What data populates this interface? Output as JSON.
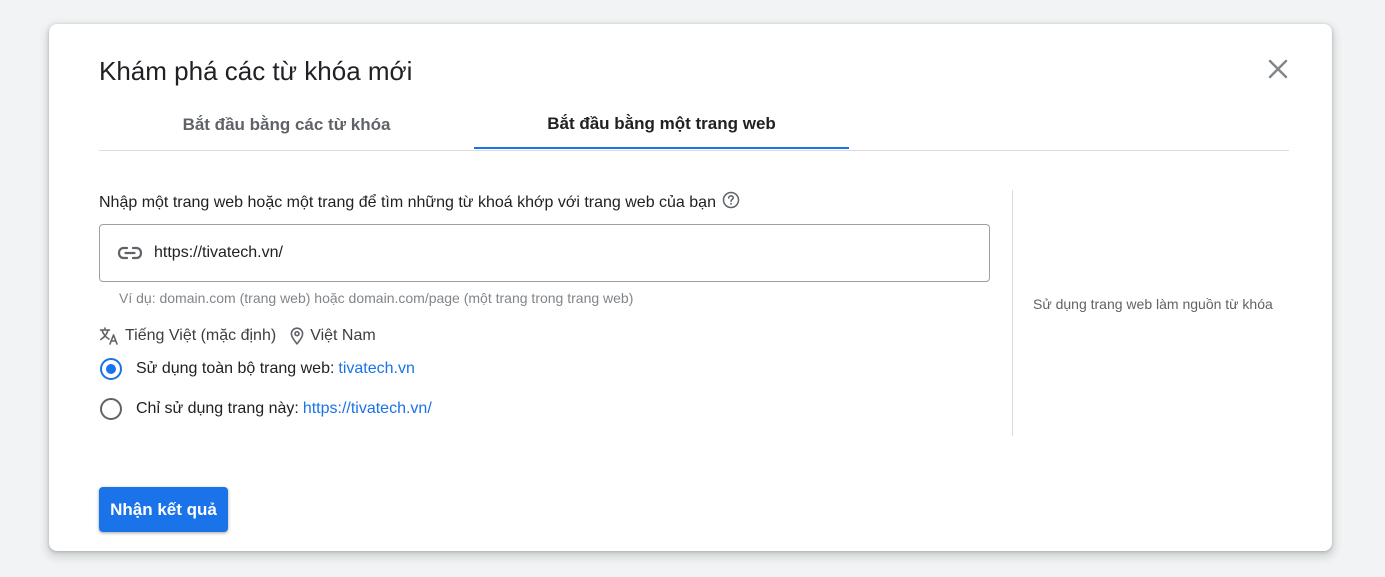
{
  "dialog": {
    "title": "Khám phá các từ khóa mới",
    "close_icon": "close-icon"
  },
  "tabs": [
    {
      "label": "Bắt đầu bằng các từ khóa",
      "active": false
    },
    {
      "label": "Bắt đầu bằng một trang web",
      "active": true
    }
  ],
  "website_form": {
    "prompt": "Nhập một trang web hoặc một trang để tìm những từ khoá khớp với trang web của bạn",
    "help_icon": "help-circle-icon",
    "link_icon": "link-icon",
    "url_value": "https://tivatech.vn/",
    "hint": "Ví dụ: domain.com (trang web) hoặc domain.com/page (một trang trong trang web)",
    "language_icon": "translate-icon",
    "language": "Tiếng Việt (mặc định)",
    "location_icon": "location-pin-icon",
    "location": "Việt Nam",
    "options": [
      {
        "label": "Sử dụng toàn bộ trang web:",
        "link": "tivatech.vn",
        "checked": true
      },
      {
        "label": "Chỉ sử dụng trang này:",
        "link": "https://tivatech.vn/",
        "checked": false
      }
    ]
  },
  "side_panel": {
    "note": "Sử dụng trang web làm nguồn từ khóa"
  },
  "footer": {
    "submit_label": "Nhận kết quả"
  },
  "colors": {
    "accent": "#1a73e8",
    "text": "#202124",
    "muted": "#5f6368",
    "divider": "#dadce0"
  }
}
